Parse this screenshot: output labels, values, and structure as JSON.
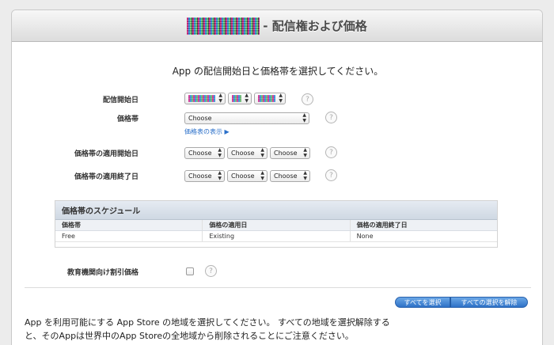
{
  "header": {
    "title": "- 配信権および価格"
  },
  "intro": "App の配信開始日と価格帯を選択してください。",
  "release_date": {
    "label": "配信開始日"
  },
  "price_tier": {
    "label": "価格帯",
    "selected": "Choose",
    "link": "価格表の表示 ▶"
  },
  "start_date": {
    "label": "価格帯の適用開始日",
    "month": "Choose",
    "day": "Choose",
    "year": "Choose"
  },
  "end_date": {
    "label": "価格帯の適用終了日",
    "month": "Choose",
    "day": "Choose",
    "year": "Choose"
  },
  "help_glyph": "?",
  "schedule": {
    "title": "価格帯のスケジュール",
    "columns": [
      "価格帯",
      "価格の適用日",
      "価格の適用終了日"
    ],
    "rows": [
      [
        "Free",
        "Existing",
        "None"
      ]
    ]
  },
  "education": {
    "label": "教育機関向け割引価格"
  },
  "buttons": {
    "select_all": "すべてを選択",
    "deselect_all": "すべての選択を解除"
  },
  "bottom_text": {
    "line1": "App を利用可能にする App Store の地域を選択してください。 すべての地域を選択解除する",
    "line2": "と、そのAppは世界中のApp Storeの全地域から削除されることにご注意ください。"
  },
  "icons": {
    "help": "help-icon",
    "select_arrows": "updown-arrows-icon",
    "triangle": "triangle-right-icon"
  }
}
